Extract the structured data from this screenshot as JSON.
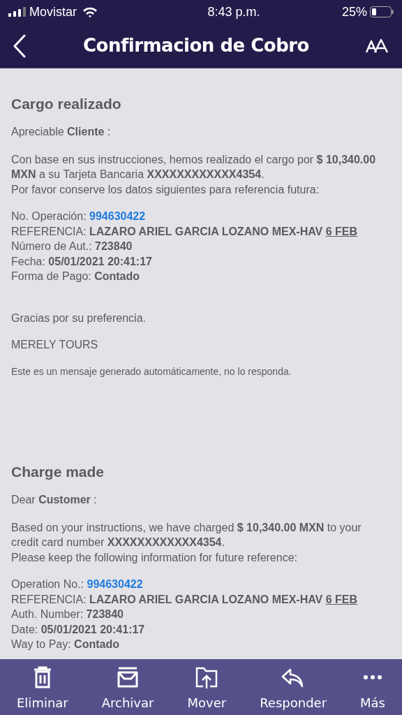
{
  "status_bar": {
    "carrier": "Movistar",
    "time": "8:43 p.m.",
    "battery": "25%"
  },
  "header": {
    "title": "Confirmacion de Cobro"
  },
  "sections": [
    {
      "title": "Cargo realizado",
      "greeting": "Apreciable **Cliente** :",
      "body": [
        "Con base en sus instrucciones, hemos realizado el cargo por **$ 10,340.00 MXN** a su Tarjeta Bancaria **XXXXXXXXXXXX4354**.",
        "Por favor conserve los datos siguientes para referencia futura:"
      ],
      "details": [
        {
          "label": "No. Operación: ",
          "value": "994630422",
          "kind": "link"
        },
        {
          "label": "REFERENCIA: ",
          "value": "LAZARO ARIEL GARCIA LOZANO MEX-HAV",
          "underlined": "6 FEB",
          "kind": "bold"
        },
        {
          "label": "Número de Aut.: ",
          "value": "723840",
          "kind": "bold"
        },
        {
          "label": "Fecha: ",
          "value": "05/01/2021 20:41:17",
          "kind": "bold"
        },
        {
          "label": "Forma de Pago: ",
          "value": "Contado",
          "kind": "bold"
        }
      ],
      "thanks": "Gracias por su preferencia.",
      "signature": "MERELY TOURS",
      "notice": "Este es un mensaje generado automáticamente, no lo responda."
    },
    {
      "title": "Charge made",
      "greeting": "Dear **Customer** :",
      "body": [
        "Based on your instructions, we have charged **$ 10,340.00 MXN**  to your credit card number **XXXXXXXXXXXX4354**.",
        "Please keep the following information for future reference:"
      ],
      "details": [
        {
          "label": "Operation No.: ",
          "value": "994630422",
          "kind": "link"
        },
        {
          "label": "REFERENCIA: ",
          "value": "LAZARO ARIEL GARCIA LOZANO MEX-HAV",
          "underlined": "6 FEB",
          "kind": "bold"
        },
        {
          "label": "Auth. Number: ",
          "value": "723840",
          "kind": "bold"
        },
        {
          "label": "Date: ",
          "value": "05/01/2021 20:41:17",
          "kind": "bold"
        },
        {
          "label": "Way to Pay: ",
          "value": "Contado",
          "kind": "bold"
        }
      ]
    }
  ],
  "toolbar": [
    {
      "label": "Eliminar",
      "kind": "trash"
    },
    {
      "label": "Archivar",
      "kind": "archive"
    },
    {
      "label": "Mover",
      "kind": "move"
    },
    {
      "label": "Responder",
      "kind": "reply"
    },
    {
      "label": "Más",
      "kind": "more"
    }
  ]
}
